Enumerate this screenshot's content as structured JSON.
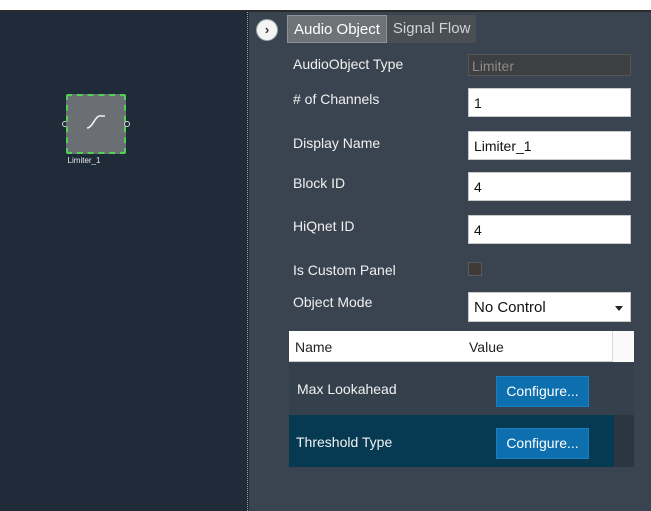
{
  "canvas": {
    "block": {
      "label": "Limiter_1",
      "icon": "limiter-curve-icon"
    }
  },
  "panel": {
    "tabs": [
      {
        "label": "Audio Object",
        "active": true
      },
      {
        "label": "Signal Flow",
        "active": false
      }
    ],
    "properties": {
      "audio_object_type": {
        "label": "AudioObject Type",
        "value": "Limiter"
      },
      "num_channels": {
        "label": "# of Channels",
        "value": "1"
      },
      "display_name": {
        "label": "Display Name",
        "value": "Limiter_1"
      },
      "block_id": {
        "label": "Block ID",
        "value": "4"
      },
      "hiqnet_id": {
        "label": "HiQnet ID",
        "value": "4"
      },
      "is_custom_panel": {
        "label": "Is Custom Panel",
        "checked": false
      },
      "object_mode": {
        "label": "Object Mode",
        "value": "No Control"
      }
    },
    "table": {
      "columns": [
        "Name",
        "Value"
      ],
      "rows": [
        {
          "name": "Max Lookahead",
          "button": "Configure..."
        },
        {
          "name": "Threshold Type",
          "button": "Configure..."
        }
      ]
    }
  },
  "colors": {
    "canvas_bg": "#1f2b38",
    "panel_bg": "#3a4450",
    "accent_button": "#0e6fae",
    "selected_row": "#063a52",
    "block_selection": "#52d052"
  }
}
